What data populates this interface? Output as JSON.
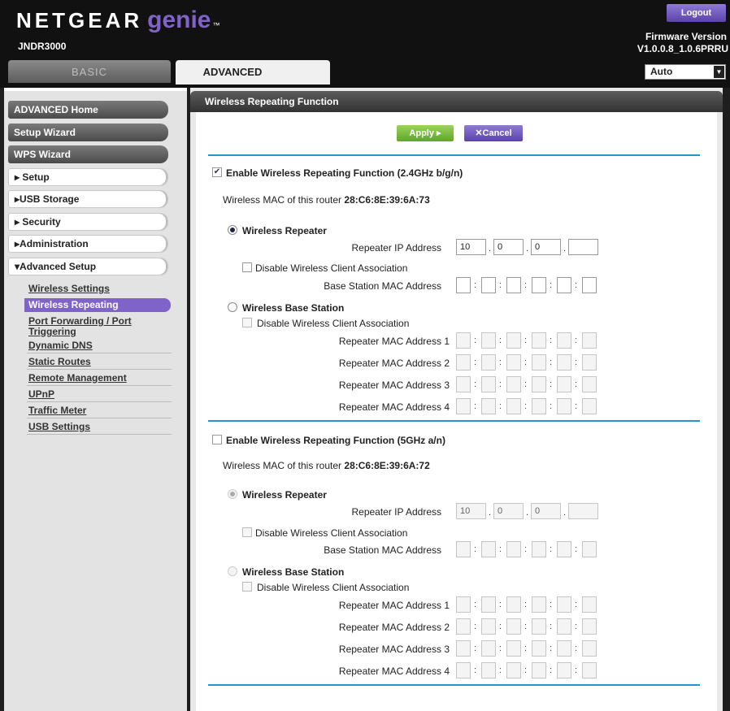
{
  "header": {
    "brand": "NETGEAR",
    "product": "genie",
    "tm": "™",
    "model": "JNDR3000",
    "logout_label": "Logout",
    "firmware_label": "Firmware Version",
    "firmware_value": "V1.0.0.8_1.0.6PRRU",
    "language_value": "Auto",
    "tabs": {
      "basic": "BASIC",
      "advanced": "ADVANCED"
    },
    "colors": {
      "accent_purple": "#7f63c8",
      "header_bg": "#111111"
    }
  },
  "sidebar": {
    "top_buttons": [
      "ADVANCED Home",
      "Setup Wizard",
      "WPS Wizard"
    ],
    "sections": [
      "▸ Setup",
      "▸USB Storage",
      "▸ Security",
      "▸Administration",
      "▾Advanced Setup"
    ],
    "advanced_setup_items": [
      "Wireless Settings",
      "Wireless Repeating",
      "Port Forwarding / Port",
      "Triggering",
      "Dynamic DNS",
      "Static Routes",
      "Remote Management",
      "UPnP",
      "Traffic Meter",
      "USB Settings"
    ],
    "active_item": "Wireless Repeating"
  },
  "main": {
    "title": "Wireless Repeating Function",
    "apply_label": "Apply ▸",
    "cancel_label": "✕Cancel",
    "band24": {
      "enable_label": "Enable Wireless Repeating Function (2.4GHz b/g/n)",
      "enabled": true,
      "mac_label": "Wireless MAC of this router",
      "mac_value": "28:C6:8E:39:6A:73",
      "repeater_label": "Wireless Repeater",
      "repeater_ip_label": "Repeater IP Address",
      "repeater_ip": [
        "10",
        "0",
        "0",
        ""
      ],
      "disable_client_label": "Disable Wireless Client Association",
      "base_mac_label": "Base Station MAC Address",
      "base_station_label": "Wireless Base Station",
      "disable_client_label2": "Disable Wireless Client Association",
      "repeater_mac_labels": [
        "Repeater MAC Address 1",
        "Repeater MAC Address 2",
        "Repeater MAC Address 3",
        "Repeater MAC Address 4"
      ]
    },
    "band5": {
      "enable_label": "Enable Wireless Repeating Function (5GHz a/n)",
      "enabled": false,
      "mac_label": "Wireless MAC of this router",
      "mac_value": "28:C6:8E:39:6A:72",
      "repeater_label": "Wireless Repeater",
      "repeater_ip_label": "Repeater IP Address",
      "repeater_ip": [
        "10",
        "0",
        "0",
        ""
      ],
      "disable_client_label": "Disable Wireless Client Association",
      "base_mac_label": "Base Station MAC Address",
      "base_station_label": "Wireless Base Station",
      "disable_client_label2": "Disable Wireless Client Association",
      "repeater_mac_labels": [
        "Repeater MAC Address 1",
        "Repeater MAC Address 2",
        "Repeater MAC Address 3",
        "Repeater MAC Address 4"
      ]
    }
  }
}
